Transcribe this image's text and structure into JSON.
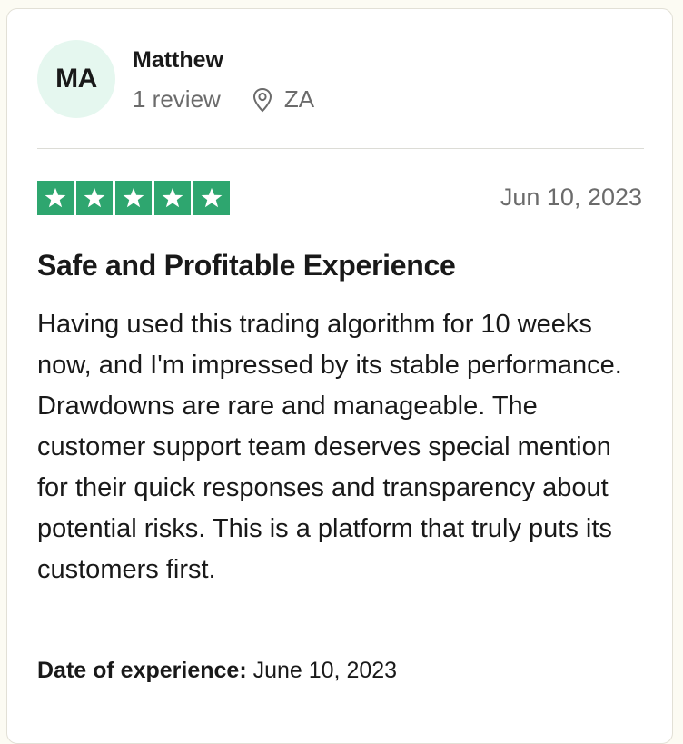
{
  "reviewer": {
    "initials": "MA",
    "name": "Matthew",
    "review_count": "1 review",
    "country": "ZA"
  },
  "review": {
    "rating": 5,
    "rating_max": 5,
    "date": "Jun 10, 2023",
    "title": "Safe and Profitable Experience",
    "body": "Having used this trading algorithm for 10 weeks now, and I'm impressed by its stable performance. Drawdowns are rare and manageable. The customer support team deserves special mention for their quick responses and transparency about potential risks. This is a platform that truly puts its customers first.",
    "experience_label": "Date of experience:",
    "experience_date": "June 10, 2023"
  },
  "colors": {
    "star_green": "#2ea66f",
    "avatar_bg": "#e5f7ef"
  },
  "icons": {
    "location": "map-pin-icon",
    "star": "star-icon"
  }
}
